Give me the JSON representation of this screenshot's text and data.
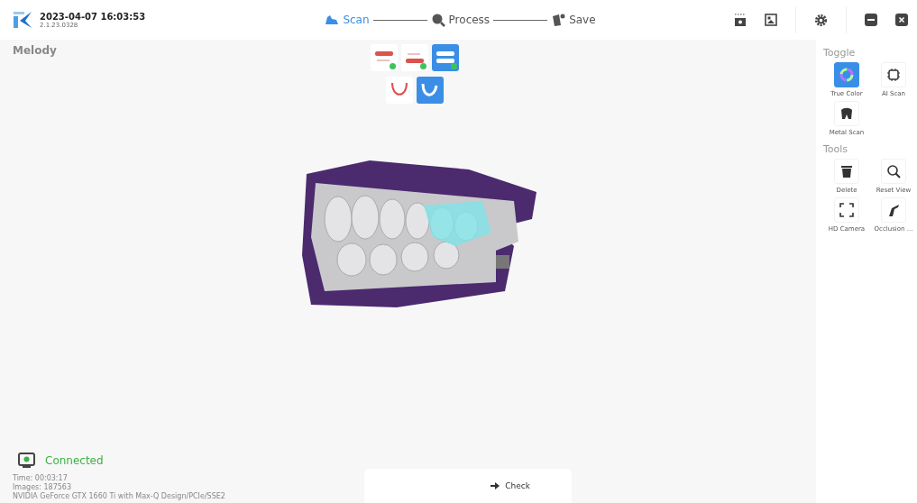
{
  "header": {
    "timestamp": "2023-04-07 16:03:53",
    "version": "2.1.23.0328"
  },
  "steps": [
    {
      "label": "Scan",
      "selected": true
    },
    {
      "label": "Process",
      "selected": false
    },
    {
      "label": "Save",
      "selected": false
    }
  ],
  "patient": "Melody",
  "jaw_modes": [
    {
      "kind": "upper",
      "selected": false,
      "done": true
    },
    {
      "kind": "lower",
      "selected": false,
      "done": true
    },
    {
      "kind": "bite",
      "selected": true,
      "done": true
    }
  ],
  "scan_types": [
    {
      "kind": "arch",
      "selected": false
    },
    {
      "kind": "clear",
      "selected": true
    }
  ],
  "toggle": {
    "title": "Toggle",
    "items": [
      {
        "kind": "color",
        "label": "True Color",
        "selected": true
      },
      {
        "kind": "ai",
        "label": "AI Scan",
        "selected": false
      },
      {
        "kind": "metal",
        "label": "Metal Scan",
        "selected": false
      }
    ]
  },
  "tools": {
    "title": "Tools",
    "items": [
      {
        "kind": "delete",
        "label": "Delete"
      },
      {
        "kind": "reset",
        "label": "Reset View"
      },
      {
        "kind": "hd",
        "label": "HD Camera"
      },
      {
        "kind": "occlusion",
        "label": "Occlusion ..."
      }
    ]
  },
  "status": {
    "label": "Connected",
    "connected": true
  },
  "info": [
    "Time: 00:03:17",
    "Images: 187563",
    "NVIDIA GeForce GTX 1660 Ti with Max-Q Design/PCIe/SSE2"
  ],
  "check_button": "Check"
}
